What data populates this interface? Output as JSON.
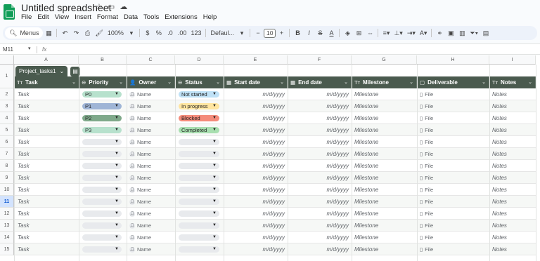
{
  "app": {
    "title": "Untitled spreadsheet",
    "menu": [
      "File",
      "Edit",
      "View",
      "Insert",
      "Format",
      "Data",
      "Tools",
      "Extensions",
      "Help"
    ]
  },
  "toolbar": {
    "menus_label": "Menus",
    "zoom": "100%",
    "currency": "$",
    "percent": "%",
    "dec_decrease": ".0",
    "dec_increase": ".00",
    "number_format": "123",
    "font": "Defaul...",
    "font_size": "10"
  },
  "formula_bar": {
    "cell_ref": "M11",
    "fx": "fx"
  },
  "columns": [
    "A",
    "B",
    "C",
    "D",
    "E",
    "F",
    "G",
    "H",
    "I"
  ],
  "rows": [
    "1",
    "2",
    "3",
    "4",
    "5",
    "6",
    "7",
    "8",
    "9",
    "10",
    "11",
    "12",
    "13",
    "14",
    "15"
  ],
  "selected_row": "11",
  "table": {
    "name": "Project_tasks1",
    "headers": [
      {
        "label": "Task",
        "icon": "Tт"
      },
      {
        "label": "Priority",
        "icon": "⊖"
      },
      {
        "label": "Owner",
        "icon": "👤"
      },
      {
        "label": "Status",
        "icon": "⊖"
      },
      {
        "label": "Start date",
        "icon": "▦"
      },
      {
        "label": "End date",
        "icon": "▦"
      },
      {
        "label": "Milestone",
        "icon": "Tт"
      },
      {
        "label": "Deliverable",
        "icon": "▢"
      },
      {
        "label": "Notes",
        "icon": "Tт"
      }
    ],
    "placeholders": {
      "task": "Task",
      "owner": "Name",
      "date": "m/d/yyyy",
      "milestone": "Milestone",
      "deliverable": "File",
      "notes": "Notes"
    },
    "rows": [
      {
        "priority": "P0",
        "priority_color": "#b7e1cd",
        "status": "Not started",
        "status_color": "#bfe1f6"
      },
      {
        "priority": "P1",
        "priority_color": "#9fb5d6",
        "status": "In progress",
        "status_color": "#ffe5a0"
      },
      {
        "priority": "P2",
        "priority_color": "#7fa98a",
        "status": "Blocked",
        "status_color": "#f48b7a"
      },
      {
        "priority": "P3",
        "priority_color": "#b7e1cd",
        "status": "Completed",
        "status_color": "#a8dfb0"
      },
      {
        "priority": "",
        "priority_color": "#e8eaed",
        "status": "",
        "status_color": "#e8eaed"
      },
      {
        "priority": "",
        "priority_color": "#e8eaed",
        "status": "",
        "status_color": "#e8eaed"
      },
      {
        "priority": "",
        "priority_color": "#e8eaed",
        "status": "",
        "status_color": "#e8eaed"
      },
      {
        "priority": "",
        "priority_color": "#e8eaed",
        "status": "",
        "status_color": "#e8eaed"
      },
      {
        "priority": "",
        "priority_color": "#e8eaed",
        "status": "",
        "status_color": "#e8eaed"
      },
      {
        "priority": "",
        "priority_color": "#e8eaed",
        "status": "",
        "status_color": "#e8eaed"
      },
      {
        "priority": "",
        "priority_color": "#e8eaed",
        "status": "",
        "status_color": "#e8eaed"
      },
      {
        "priority": "",
        "priority_color": "#e8eaed",
        "status": "",
        "status_color": "#e8eaed"
      },
      {
        "priority": "",
        "priority_color": "#e8eaed",
        "status": "",
        "status_color": "#e8eaed"
      },
      {
        "priority": "",
        "priority_color": "#e8eaed",
        "status": "",
        "status_color": "#e8eaed"
      }
    ]
  },
  "colors": {
    "brand": "#0f9d58",
    "table_header": "#4a5a4e",
    "selection": "#d3e3fd"
  }
}
